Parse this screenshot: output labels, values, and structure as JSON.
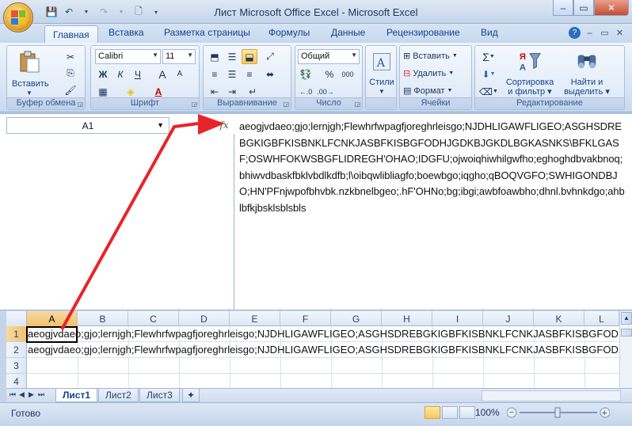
{
  "window": {
    "title": "Лист Microsoft Office Excel - Microsoft Excel",
    "min": "–",
    "restore": "▭",
    "close": "✕"
  },
  "tabs": [
    "Главная",
    "Вставка",
    "Разметка страницы",
    "Формулы",
    "Данные",
    "Рецензирование",
    "Вид"
  ],
  "ribbon": {
    "clipboard": {
      "label": "Буфер обмена",
      "paste": "Вставить"
    },
    "font": {
      "label": "Шрифт",
      "name": "Calibri",
      "size": "11",
      "bold": "Ж",
      "italic": "К",
      "underline": "Ч",
      "grow": "A",
      "shrink": "A"
    },
    "alignment": {
      "label": "Выравнивание"
    },
    "number": {
      "label": "Число",
      "format": "Общий",
      "percent": "%",
      "thousands": "000"
    },
    "styles": {
      "label": "Стили",
      "button": "Стили"
    },
    "cells": {
      "label": "Ячейки",
      "insert": "Вставить",
      "delete": "Удалить",
      "format": "Формат"
    },
    "editing": {
      "label": "Редактирование",
      "sort_l1": "Сортировка",
      "sort_l2": "и фильтр",
      "find_l1": "Найти и",
      "find_l2": "выделить",
      "sigma": "Σ"
    }
  },
  "formula_bar": {
    "name_box": "A1",
    "fx": "fx",
    "content": "aeogjvdaeo;gjo;lernjgh;Flewhrfwpagfjoreghrleisgo;NJDHLIGAWFLIGEO;ASGHSDREBGKIGBFKISBNKLFCNKJASBFKISBGFODHJGDKBJGKDLBGKASNKS\\BFKLGASF;OSWHFOKWSBGFLIDREGH'OHAO;IDGFU;ojwoiqhiwhilgwfho;eghoghdbvakbnoq;bhiwvdbaskfbklvbdlkdfb;l\\oibqwlibliagfo;boewbgo;iqgho;qBOQVGFO;SWHIGONDBJO;HN'PFnjwpofbhvbk.nzkbnelbgeo;.hF'OHNo;bg;ibgi;awbfoawbho;dhnl.bvhnkdgo;ahblbfkjbsklsblsbls"
  },
  "grid": {
    "columns": [
      "A",
      "B",
      "C",
      "D",
      "E",
      "F",
      "G",
      "H",
      "I",
      "J",
      "K",
      "L"
    ],
    "rows": [
      "1",
      "2",
      "3",
      "4"
    ],
    "row1": "aeogjvdaeo;gjo;lernjgh;Flewhrfwpagfjoreghrleisgo;NJDHLIGAWFLIGEO;ASGHSDREBGKIGBFKISBNKLFCNKJASBFKISBGFOD",
    "row2": "aeogjvdaeo;gjo;lernjgh;Flewhrfwpagfjoreghrleisgo;NJDHLIGAWFLIGEO;ASGHSDREBGKIGBFKISBNKLFCNKJASBFKISBGFOD"
  },
  "sheets": [
    "Лист1",
    "Лист2",
    "Лист3"
  ],
  "status": {
    "text": "Готово",
    "zoom": "100%"
  },
  "colors": {
    "accent": "#15428b",
    "arrow": "#e8242a"
  }
}
